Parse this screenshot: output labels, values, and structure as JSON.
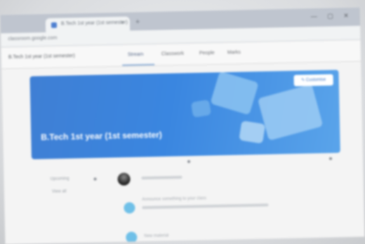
{
  "browser": {
    "tab_title": "B.Tech 1st year (1st semester)",
    "tab_close": "×",
    "new_tab": "+",
    "window_controls": "— ▢ ✕",
    "url": "classroom.google.com"
  },
  "classroom": {
    "class_title": "B.Tech 1st year (1st semester)",
    "tabs": [
      {
        "label": "Stream",
        "active": true
      },
      {
        "label": "Classwork",
        "active": false
      },
      {
        "label": "People",
        "active": false
      },
      {
        "label": "Marks",
        "active": false
      }
    ]
  },
  "banner": {
    "title": "B.Tech 1st year (1st semester)",
    "subtitle": "",
    "customize_label": "✎ Customise",
    "color": "#3f82d8"
  },
  "stream": {
    "upcoming_label": "Upcoming",
    "view_all_label": "View all",
    "post_1_text": "Announce something to your class",
    "post_2_text": "New material",
    "post_3_text": ""
  }
}
